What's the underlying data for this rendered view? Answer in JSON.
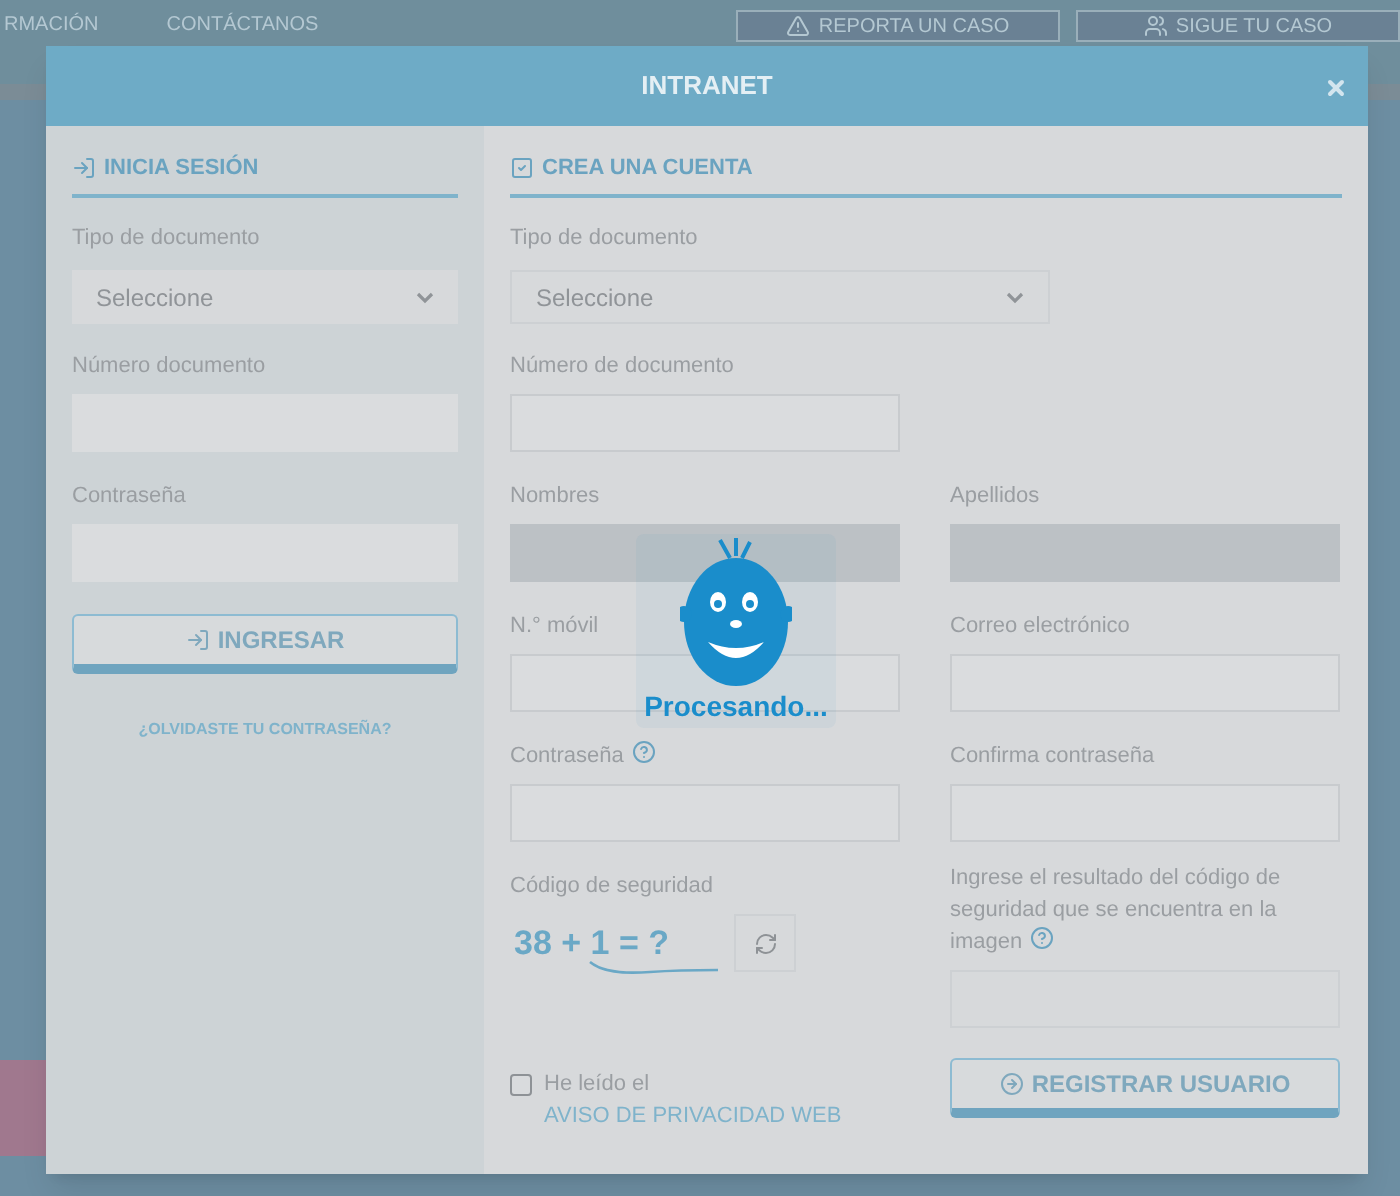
{
  "background": {
    "nav_items": [
      "RMACIÓN",
      "CONTÁCTANOS"
    ],
    "nav_buttons": [
      "REPORTA UN CASO",
      "SIGUE TU CASO"
    ]
  },
  "modal": {
    "title": "INTRANET"
  },
  "login": {
    "heading": "INICIA SESIÓN",
    "fields": [
      {
        "label": "Tipo de documento",
        "kind": "select",
        "placeholder": "Seleccione"
      },
      {
        "label": "Número documento",
        "kind": "text"
      },
      {
        "label": "Contraseña",
        "kind": "password"
      }
    ],
    "button": "INGRESAR",
    "link": "¿OLVIDASTE TU CONTRASEÑA?"
  },
  "register": {
    "heading": "CREA UNA CUENTA",
    "document_type": {
      "label": "Tipo de documento",
      "placeholder": "Seleccione"
    },
    "document_number": {
      "label": "Número de documento"
    },
    "fields": [
      {
        "label": "Nombres",
        "disabled": true,
        "help": false
      },
      {
        "label": "Apellidos",
        "disabled": true,
        "help": false
      },
      {
        "label": "N.° móvil",
        "disabled": false,
        "help": false
      },
      {
        "label": "Correo electrónico",
        "disabled": false,
        "help": false
      },
      {
        "label": "Contraseña",
        "disabled": false,
        "help": true
      },
      {
        "label": "Confirma contraseña",
        "disabled": false,
        "help": false
      }
    ],
    "captcha": {
      "label": "Código de seguridad",
      "challenge": "38 + 1 = ?",
      "answer_label": "Ingrese el resultado del código de seguridad que se encuentra en la imagen",
      "answer_help": true
    },
    "privacy": {
      "checked": false,
      "text": "He leído el",
      "link": "AVISO DE PRIVACIDAD WEB"
    },
    "button": "REGISTRAR USUARIO"
  },
  "loading": {
    "text": "Procesando..."
  }
}
